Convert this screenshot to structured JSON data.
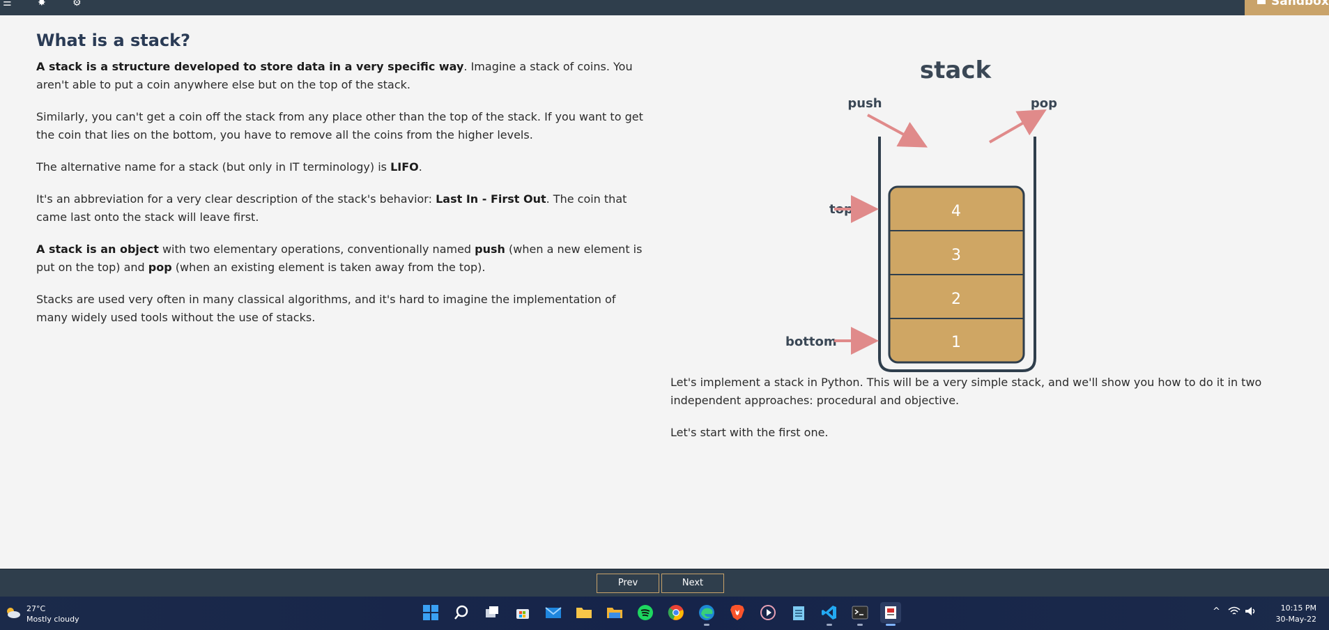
{
  "sandbox_label": "Sandbox",
  "title": "What is a stack?",
  "left_paragraphs": {
    "p1_bold": "A stack is a structure developed to store data in a very specific way",
    "p1_rest": ". Imagine a stack of coins. You aren't able to put a coin anywhere else but on the top of the stack.",
    "p2": "Similarly, you can't get a coin off the stack from any place other than the top of the stack. If you want to get the coin that lies on the bottom, you have to remove all the coins from the higher levels.",
    "p3_pre": "The alternative name for a stack (but only in IT terminology) is ",
    "p3_bold": "LIFO",
    "p3_post": ".",
    "p4_pre": "It's an abbreviation for a very clear description of the stack's behavior: ",
    "p4_bold": "Last In - First Out",
    "p4_post": ". The coin that came last onto the stack will leave first.",
    "p5_bold1": "A stack is an object",
    "p5_mid1": " with two elementary operations, conventionally named ",
    "p5_bold2": "push",
    "p5_mid2": " (when a new element is put on the top) and ",
    "p5_bold3": "pop",
    "p5_post": " (when an existing element is taken away from the top).",
    "p6": "Stacks are used very often in many classical algorithms, and it's hard to imagine the implementation of many widely used tools without the use of stacks."
  },
  "diagram": {
    "title": "stack",
    "push_label": "push",
    "pop_label": "pop",
    "top_label": "top",
    "bottom_label": "bottom",
    "items": [
      "4",
      "3",
      "2",
      "1"
    ],
    "colors": {
      "box": "#cfa664",
      "outline": "#2f3e4c",
      "arrow": "#e08a8a"
    }
  },
  "right_paragraphs": {
    "p1": "Let's implement a stack in Python. This will be a very simple stack, and we'll show you how to do it in two independent approaches: procedural and objective.",
    "p2": "Let's start with the first one."
  },
  "pager": {
    "prev": "Prev",
    "next": "Next"
  },
  "taskbar": {
    "weather_temp": "27°C",
    "weather_desc": "Mostly cloudy",
    "time": "10:15 PM",
    "date": "30-May-22"
  }
}
